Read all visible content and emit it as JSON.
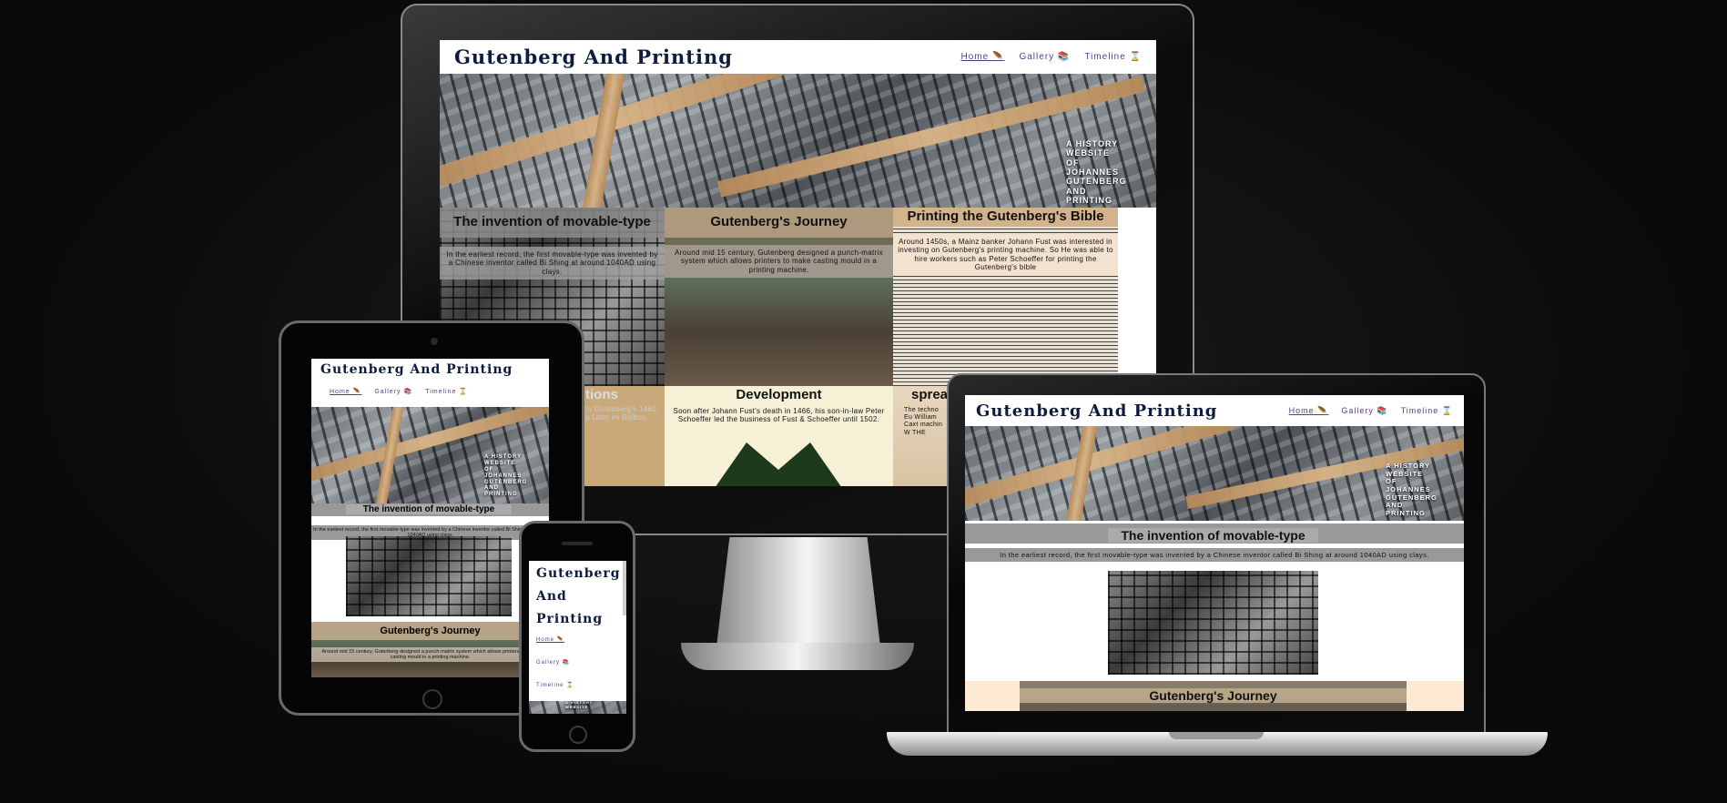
{
  "site": {
    "title": "Gutenberg And Printing",
    "title_words": [
      "Gutenberg",
      "And",
      "Printing"
    ],
    "nav": {
      "home": "Home 🪶",
      "gallery": "Gallery 📚",
      "timeline": "Timeline ⌛"
    },
    "hero_tagline": [
      "A HISTORY",
      "WEBSITE",
      "OF",
      "JOHANNES",
      "GUTENBERG",
      "AND",
      "PRINTING"
    ],
    "hero_tagline_small": [
      "A HISTORY",
      "WEBSITE",
      "OF",
      "JOHANNES",
      "GUTENBERG",
      "AND",
      "PRINTING"
    ]
  },
  "desktop": {
    "cards": [
      {
        "title": "The invention of movable-type",
        "text": "In the earliest record, the first movable-type was invented by a Chinese inventor called Bi Shing at around 1040AD using clays."
      },
      {
        "title": "Gutenberg's Journey",
        "text": "Around mid 15 century, Gutenberg designed a punch-matrix system which allows printers to make casting mould in a printing machine."
      },
      {
        "title": "Printing the Gutenberg's Bible",
        "text": "Around 1450s, a Mainz banker Johann Fust was interested in investing on Gutenberg's printing machine. So He was able to hire workers such as Peter Schoeffer for printing the Gutenberg's bible"
      }
    ],
    "row2": [
      {
        "title": "tions",
        "text": "to Gutenberg's 1460, a Latin es Balbus."
      },
      {
        "title": "Development",
        "text": "Soon after Johann Fust's death in 1466, his son-in-law Peter Schoeffer led the business of Fust & Schoeffer until 1502."
      },
      {
        "title": "sprea",
        "text": "The techno Eu William Caxt machin W THE"
      }
    ]
  },
  "tablet": {
    "card1": {
      "title": "The invention of movable-type",
      "text": "In the earliest record, the first movable-type was invented by a Chinese inventor called Bi Shing at around 1040AD using clays."
    },
    "card2": {
      "title": "Gutenberg's Journey",
      "text": "Around mid 15 century, Gutenberg designed a punch-matrix system which allows printers to make casting mould in a printing machine."
    }
  },
  "laptop": {
    "card1": {
      "title": "The invention of movable-type",
      "text": "In the earliest record, the first movable-type was invented by a Chinese inventor called Bi Shing at around 1040AD using clays."
    },
    "card2": {
      "title": "Gutenberg's Journey"
    }
  },
  "phone": {
    "hero_tagline": [
      "A HISTORY",
      "WEBSITE"
    ]
  }
}
